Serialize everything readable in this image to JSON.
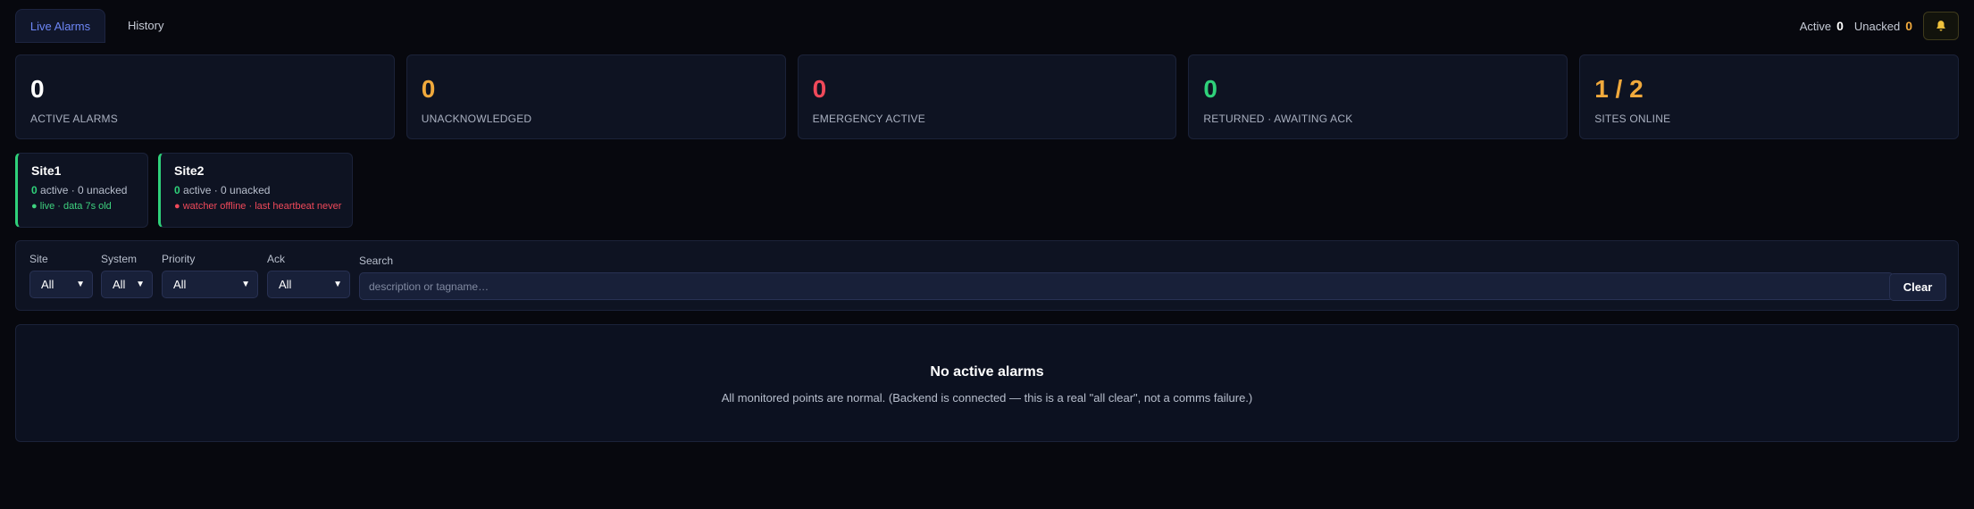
{
  "tabs": [
    {
      "label": "Live Alarms",
      "active": true
    },
    {
      "label": "History",
      "active": false
    }
  ],
  "header_status": {
    "active_label": "Active",
    "active_value": "0",
    "unacked_label": "Unacked",
    "unacked_value": "0"
  },
  "summary_cards": [
    {
      "value": "0",
      "label": "ACTIVE ALARMS",
      "color": "#ffffff"
    },
    {
      "value": "0",
      "label": "UNACKNOWLEDGED",
      "color": "#f0a93c"
    },
    {
      "value": "0",
      "label": "EMERGENCY ACTIVE",
      "color": "#f0495a"
    },
    {
      "value": "0",
      "label": "RETURNED · AWAITING ACK",
      "color": "#2fd17a"
    },
    {
      "value": "1 / 2",
      "label": "SITES ONLINE",
      "color": "#f0a93c"
    }
  ],
  "sites": [
    {
      "name": "Site1",
      "active": "0",
      "counts_rest": "active · 0 unacked",
      "status": "● live · data 7s old",
      "status_color": "#3ed27f"
    },
    {
      "name": "Site2",
      "active": "0",
      "counts_rest": "active · 0 unacked",
      "status": "● watcher offline · last heartbeat never",
      "status_color": "#f0495a"
    }
  ],
  "filters": {
    "site": {
      "label": "Site",
      "value": "All"
    },
    "system": {
      "label": "System",
      "value": "All"
    },
    "priority": {
      "label": "Priority",
      "value": "All"
    },
    "ack": {
      "label": "Ack",
      "value": "All"
    },
    "search": {
      "label": "Search",
      "placeholder": "description or tagname…"
    },
    "clear_label": "Clear"
  },
  "empty_state": {
    "title": "No active alarms",
    "message": "All monitored points are normal. (Backend is connected — this is a real \"all clear\", not a comms failure.)"
  },
  "icons": {
    "bell": "bell-icon",
    "chevron": "chevron-down-icon"
  },
  "colors": {
    "accent": "#6d86f5",
    "ok": "#2fd17a",
    "warn": "#f0a93c",
    "error": "#f0495a"
  }
}
